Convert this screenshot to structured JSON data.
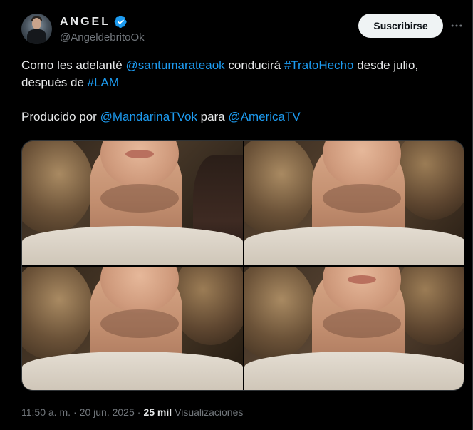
{
  "author": {
    "display_name": "ANGEL",
    "handle": "@AngeldebritoOk",
    "verified": true,
    "verified_color": "#1d9bf0"
  },
  "actions": {
    "subscribe_label": "Suscribirse",
    "more_icon": "more-horizontal-icon"
  },
  "tweet": {
    "line1": {
      "t1": "Como les adelanté ",
      "mention1": "@santumarateaok",
      "t2": " conducirá ",
      "hashtag1": "#TratoHecho",
      "t3": " desde julio, después de ",
      "hashtag2": "#LAM"
    },
    "line2": {
      "t1": "Producido por ",
      "mention1": "@MandarinaTVok",
      "t2": " para ",
      "mention2": "@AmericaTV"
    }
  },
  "media": {
    "count": 4
  },
  "meta": {
    "time": "11:50 a. m.",
    "separator": "·",
    "date": "20 jun. 2025",
    "views_count": "25 mil",
    "views_label": "Visualizaciones"
  },
  "colors": {
    "background": "#000000",
    "text": "#e7e9ea",
    "secondary": "#71767b",
    "link": "#1d9bf0",
    "button_bg": "#eff3f4"
  }
}
